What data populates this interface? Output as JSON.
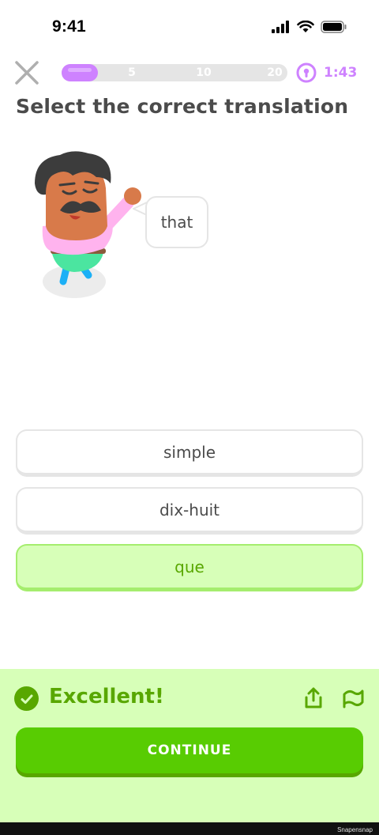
{
  "status_bar": {
    "time": "9:41"
  },
  "header": {
    "progress": 0.16,
    "milestones": [
      "5",
      "10",
      "20"
    ],
    "timer": "1:43"
  },
  "prompt": "Select the correct translation",
  "speech_bubble": "that",
  "options": [
    "simple",
    "dix-huit",
    "que"
  ],
  "selected_option": "que",
  "feedback": {
    "title": "Excellent!",
    "continue_label": "CONTINUE"
  },
  "watermark": "Snapensnap",
  "colors": {
    "accent_green": "#58cc02",
    "correct_text": "#58a700",
    "correct_bg": "#d7ffb8",
    "progress_purple": "#ce82ff"
  }
}
